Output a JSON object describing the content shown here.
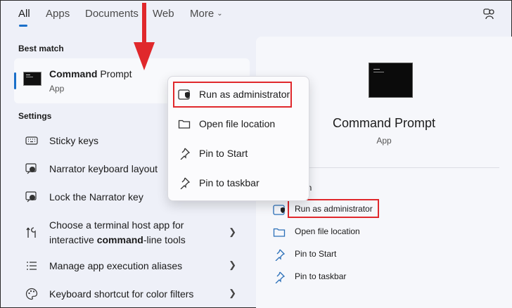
{
  "tabs": [
    {
      "label": "All",
      "active": true
    },
    {
      "label": "Apps"
    },
    {
      "label": "Documents"
    },
    {
      "label": "Web"
    },
    {
      "label": "More"
    }
  ],
  "best_match": {
    "section_title": "Best match",
    "title_bold": "Command",
    "title_rest": " Prompt",
    "subtitle": "App"
  },
  "settings": {
    "section_title": "Settings",
    "items": [
      {
        "label": "Sticky keys",
        "icon": "keyboard-icon"
      },
      {
        "label": "Narrator keyboard layout",
        "icon": "narrator-icon"
      },
      {
        "label": "Lock the Narrator key",
        "icon": "narrator-icon"
      },
      {
        "line1": "Choose a terminal host app for",
        "line2_pre": "interactive ",
        "line2_bold": "command",
        "line2_post": "-line tools",
        "icon": "tools-icon",
        "chevron": true
      },
      {
        "label": "Manage app execution aliases",
        "icon": "list-icon",
        "chevron": true
      },
      {
        "label": "Keyboard shortcut for color filters",
        "icon": "palette-icon",
        "chevron": true
      }
    ]
  },
  "context_menu": {
    "items": [
      {
        "label": "Run as administrator",
        "icon": "shield-icon",
        "highlighted": true
      },
      {
        "label": "Open file location",
        "icon": "folder-icon"
      },
      {
        "label": "Pin to Start",
        "icon": "pin-icon"
      },
      {
        "label": "Pin to taskbar",
        "icon": "pin-icon"
      }
    ]
  },
  "detail_panel": {
    "title": "Command Prompt",
    "subtitle": "App",
    "open_partial": "en",
    "actions": [
      {
        "label": "Run as administrator",
        "icon": "shield-icon",
        "highlighted": true
      },
      {
        "label": "Open file location",
        "icon": "folder-icon"
      },
      {
        "label": "Pin to Start",
        "icon": "pin-icon"
      },
      {
        "label": "Pin to taskbar",
        "icon": "pin-icon"
      }
    ]
  },
  "colors": {
    "accent": "#1a6fc9",
    "highlight_box": "#e0282c",
    "annotation_arrow": "#e0282c"
  }
}
